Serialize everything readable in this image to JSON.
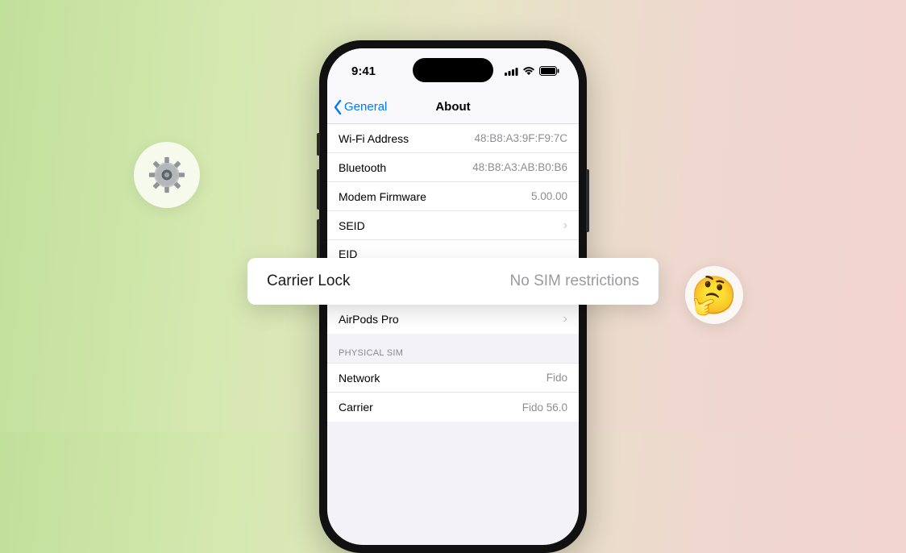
{
  "statusbar": {
    "time": "9:41"
  },
  "nav": {
    "back": "General",
    "title": "About"
  },
  "rows": {
    "wifi_label": "Wi-Fi Address",
    "wifi_value": "48:B8:A3:9F:F9:7C",
    "bt_label": "Bluetooth",
    "bt_value": "48:B8:A3:AB:B0:B6",
    "modem_label": "Modem Firmware",
    "modem_value": "5.00.00",
    "seid_label": "SEID",
    "eid_label": "EID",
    "airpods_label": "AirPods Pro"
  },
  "section": {
    "physical_sim": "PHYSICAL SIM",
    "network_label": "Network",
    "network_value": "Fido",
    "carrier_label": "Carrier",
    "carrier_value": "Fido 56.0"
  },
  "callout": {
    "label": "Carrier Lock",
    "value": "No SIM restrictions"
  },
  "emoji": "🤔"
}
